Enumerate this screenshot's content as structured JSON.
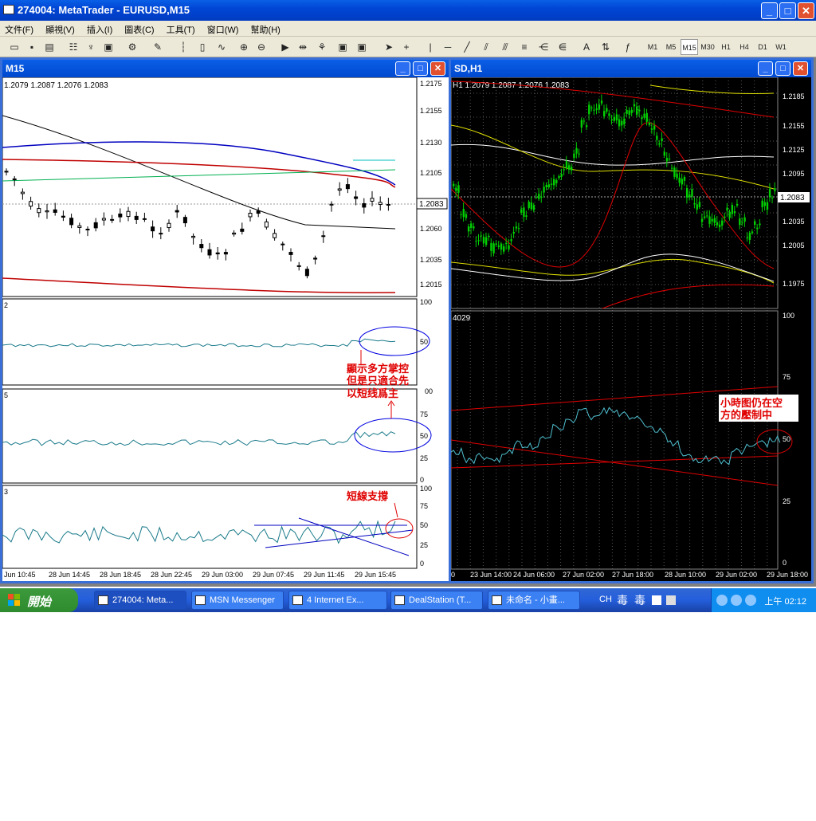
{
  "window": {
    "title": "274004: MetaTrader - EURUSD,M15",
    "min": "_",
    "max": "□",
    "close": "✕"
  },
  "menu": [
    "文件(F)",
    "顯視(V)",
    "插入(I)",
    "圖表(C)",
    "工具(T)",
    "窗口(W)",
    "幫助(H)"
  ],
  "timeframes": [
    "M1",
    "M5",
    "M15",
    "M30",
    "H1",
    "H4",
    "D1",
    "W1"
  ],
  "active_timeframe": "M15",
  "left_chart": {
    "caption": "M15",
    "ohlc": "1.2079 1.2087 1.2076 1.2083",
    "price_ticks": [
      "1.2175",
      "1.2155",
      "1.2130",
      "1.2105",
      "1.2060",
      "1.2035",
      "1.2015"
    ],
    "current_price": "1.2083",
    "ind1_ticks": [
      "100",
      "50"
    ],
    "ind1_label": "2",
    "ind2_ticks": [
      "75",
      "50",
      "25",
      "0"
    ],
    "ind2_label": "5",
    "ind2_top": "00",
    "ind3_ticks": [
      "100",
      "75",
      "50",
      "25",
      "0"
    ],
    "ind3_label": "3",
    "time_ticks": [
      "Jun 10:45",
      "28 Jun 14:45",
      "28 Jun 18:45",
      "28 Jun 22:45",
      "29 Jun 03:00",
      "29 Jun 07:45",
      "29 Jun 11:45",
      "29 Jun 15:45"
    ],
    "ann1": [
      "顯示多方掌控",
      "但是只適合先",
      "以短线爲主"
    ],
    "ann2": "短線支撐"
  },
  "right_chart": {
    "caption": "SD,H1",
    "ohlc": "H1  1.2079 1.2087 1.2076 1.2083",
    "price_ticks": [
      "1.2185",
      "1.2155",
      "1.2125",
      "1.2095",
      "1.2065",
      "1.2035",
      "1.2005",
      "1.1975"
    ],
    "current_price": "1.2083",
    "ind_value": "4029",
    "ind_ticks": [
      "100",
      "75",
      "50",
      "25",
      "0"
    ],
    "time_ticks": [
      "0",
      "23 Jun 14:00",
      "24 Jun 06:00",
      "27 Jun 02:00",
      "27 Jun 18:00",
      "28 Jun 10:00",
      "29 Jun 02:00",
      "29 Jun 18:00"
    ],
    "ann": [
      "小時图仍在空",
      "方的壓制中"
    ]
  },
  "taskbar": {
    "start": "開始",
    "tasks": [
      "274004: Meta...",
      "MSN Messenger",
      "4 Internet Ex...",
      "DealStation (T...",
      "未命名 - 小畫..."
    ],
    "ime": [
      "CH",
      "毒",
      "毒"
    ],
    "clock": "上午 02:12"
  },
  "colors": {
    "title_blue": "#0048d0",
    "chart_bg_dark": "#000000",
    "candle_green": "#00d000",
    "ann_red": "#e00000"
  }
}
